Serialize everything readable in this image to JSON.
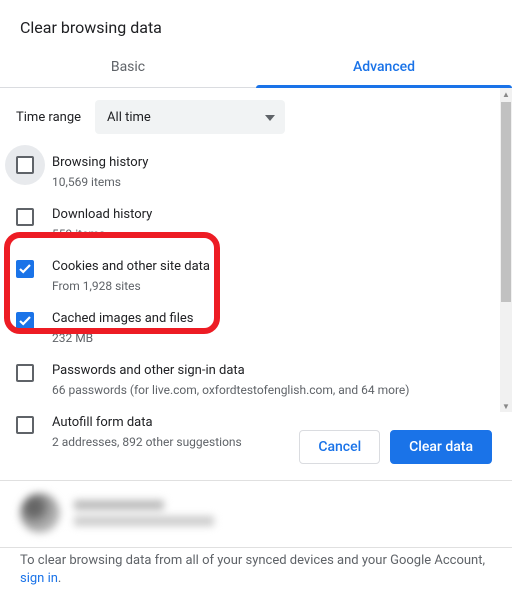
{
  "dialog": {
    "title": "Clear browsing data",
    "tabs": {
      "basic": "Basic",
      "advanced": "Advanced"
    },
    "time_range_label": "Time range",
    "time_range_value": "All time"
  },
  "items": [
    {
      "title": "Browsing history",
      "sub": "10,569 items",
      "checked": false,
      "halo": true
    },
    {
      "title": "Download history",
      "sub": "559 items",
      "checked": false,
      "halo": false
    },
    {
      "title": "Cookies and other site data",
      "sub": "From 1,928 sites",
      "checked": true,
      "halo": false
    },
    {
      "title": "Cached images and files",
      "sub": "232 MB",
      "checked": true,
      "halo": false
    },
    {
      "title": "Passwords and other sign-in data",
      "sub": "66 passwords (for live.com, oxfordtestofenglish.com, and 64 more)",
      "checked": false,
      "halo": false
    },
    {
      "title": "Autofill form data",
      "sub": "2 addresses, 892 other suggestions",
      "checked": false,
      "halo": false
    }
  ],
  "buttons": {
    "cancel": "Cancel",
    "clear": "Clear data"
  },
  "footer": {
    "text": "To clear browsing data from all of your synced devices and your Google Account, ",
    "link": "sign in",
    "tail": "."
  }
}
